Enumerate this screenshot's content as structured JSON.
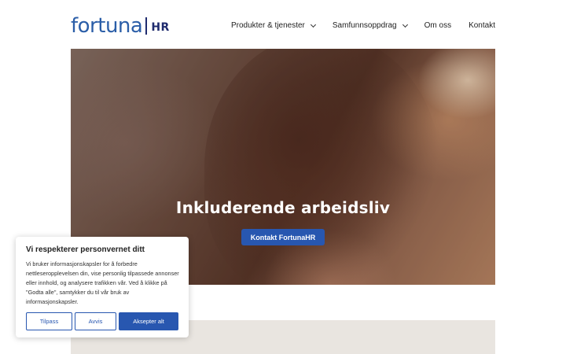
{
  "header": {
    "logo": {
      "word": "fortuna",
      "suffix": "HR"
    },
    "nav": [
      {
        "label": "Produkter & tjenester",
        "has_dropdown": true
      },
      {
        "label": "Samfunnsoppdrag",
        "has_dropdown": true
      },
      {
        "label": "Om oss",
        "has_dropdown": false
      },
      {
        "label": "Kontakt",
        "has_dropdown": false
      }
    ]
  },
  "hero": {
    "title": "Inkluderende arbeidsliv",
    "button_label": "Kontakt FortunaHR"
  },
  "cookie": {
    "title": "Vi respekterer personvernet ditt",
    "text": "Vi bruker informasjonskapsler for å forbedre nettleseropplevelsen din, vise personlig tilpassede annonser eller innhold, og analysere trafikken vår. Ved å klikke på \"Godta alle\", samtykker du til vår bruk av informasjonskapsler.",
    "buttons": {
      "customize": "Tilpass",
      "reject": "Avvis",
      "accept": "Aksepter alt"
    }
  },
  "colors": {
    "brand_blue": "#2857b0",
    "logo_blue": "#2b5ea8",
    "logo_navy": "#1f2b6e",
    "band": "#e9e5e0"
  }
}
